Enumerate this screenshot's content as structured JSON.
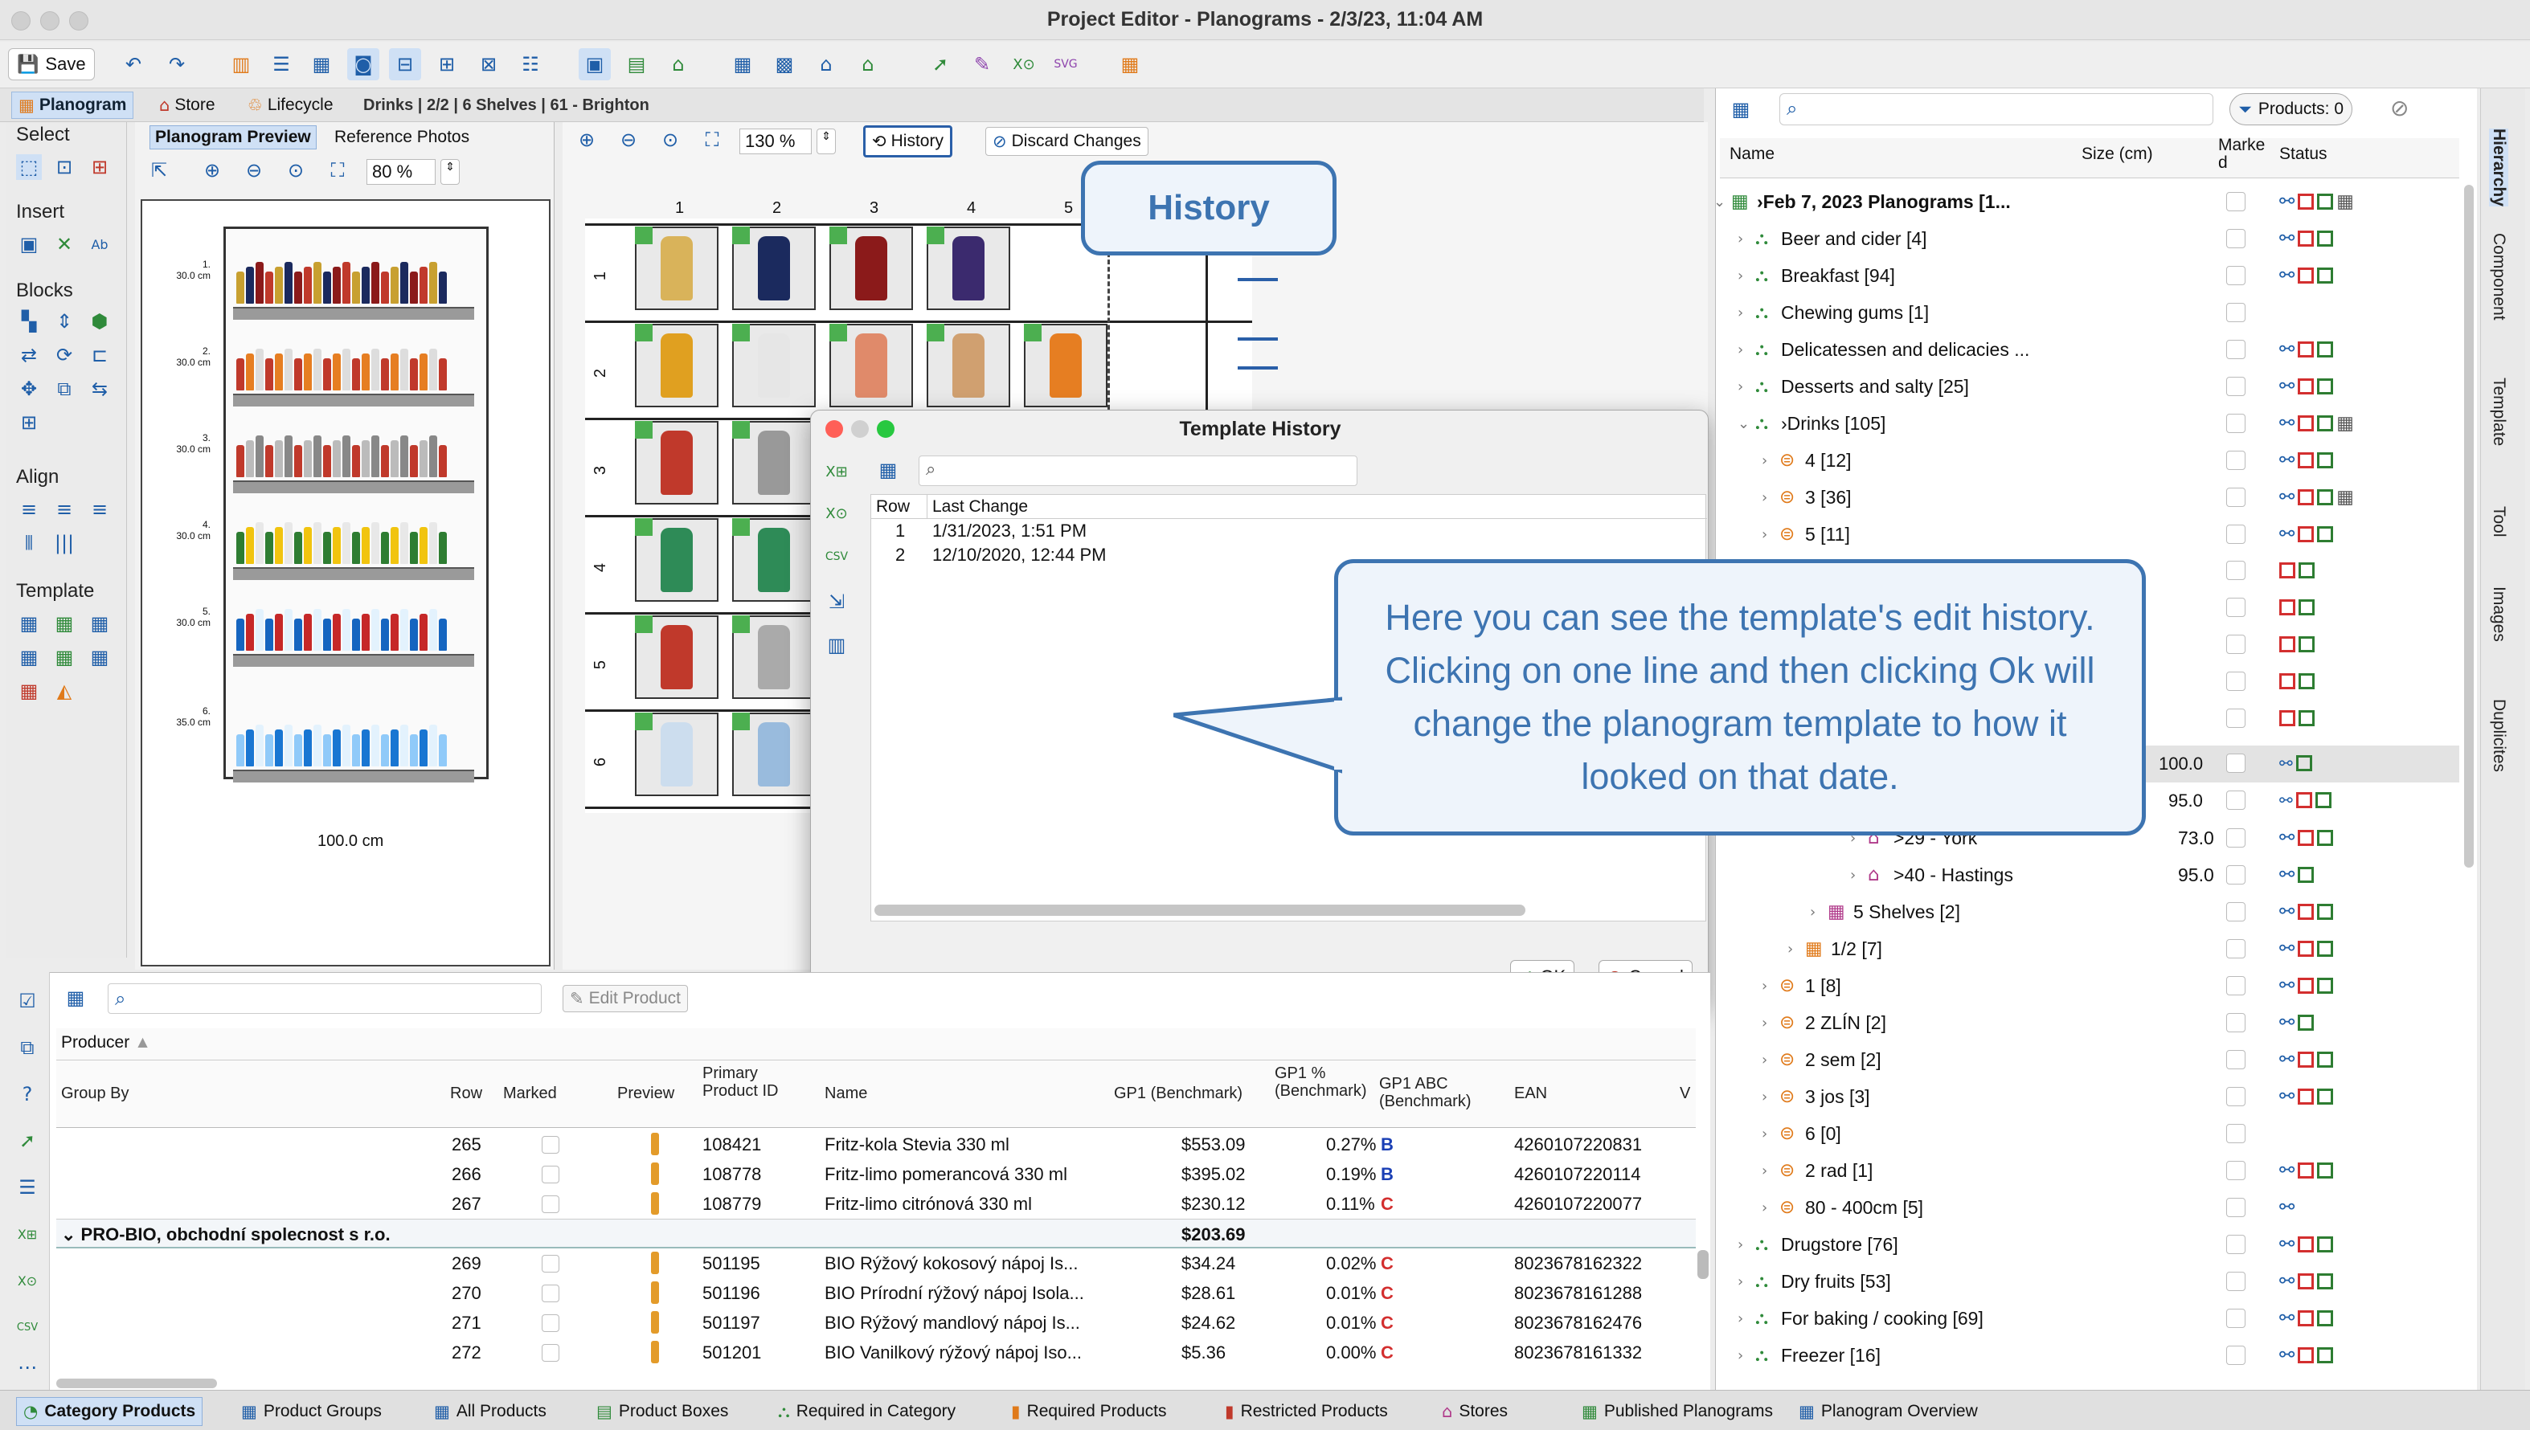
{
  "window": {
    "title": "Project Editor - Planograms - 2/3/23, 11:04 AM"
  },
  "toolbar": {
    "save_label": "Save"
  },
  "tabs": {
    "planogram": "Planogram",
    "store": "Store",
    "lifecycle": "Lifecycle",
    "breadcrumb": "Drinks | 2/2 | 6 Shelves | 61 - Brighton"
  },
  "palette": {
    "select": "Select",
    "insert": "Insert",
    "blocks": "Blocks",
    "align": "Align",
    "template": "Template"
  },
  "preview": {
    "tab_preview": "Planogram Preview",
    "tab_photos": "Reference Photos",
    "zoom": "80 %",
    "width_label": "100.0 cm",
    "shelf_labels": [
      "1.\n30.0 cm",
      "2.\n30.0 cm",
      "3.\n30.0 cm",
      "4.\n30.0 cm",
      "5.\n30.0 cm",
      "6.\n35.0 cm"
    ]
  },
  "editor": {
    "zoom": "130 %",
    "history_button": "History",
    "discard_button": "Discard Changes",
    "columns": [
      "1",
      "2",
      "3",
      "4",
      "5"
    ],
    "rows": [
      "1",
      "2",
      "3",
      "4",
      "5",
      "6"
    ]
  },
  "callouts": {
    "history": "History",
    "explanation": "Here you can see the template's edit history. Clicking on one line and then clicking Ok will change the planogram template to how it looked on that date."
  },
  "dialog": {
    "title": "Template History",
    "col_row": "Row",
    "col_change": "Last Change",
    "rows": [
      {
        "row": "1",
        "change": "1/31/2023, 1:51 PM"
      },
      {
        "row": "2",
        "change": "12/10/2020, 12:44 PM"
      }
    ],
    "ok": "OK",
    "cancel": "Cancel"
  },
  "hierarchy": {
    "products_badge": "Products: 0",
    "col_name": "Name",
    "col_size": "Size (cm)",
    "col_marked": "Marke\nd",
    "col_status": "Status",
    "items": [
      {
        "label": "›Feb 7, 2023 Planograms [1...",
        "bold": true
      },
      {
        "label": "Beer and cider [4]"
      },
      {
        "label": "Breakfast [94]"
      },
      {
        "label": "Chewing gums [1]"
      },
      {
        "label": "Delicatessen and delicacies ..."
      },
      {
        "label": "Desserts and salty [25]"
      },
      {
        "label": "›Drinks [105]"
      },
      {
        "label": "4 [12]"
      },
      {
        "label": "3 [36]"
      },
      {
        "label": "5 [11]"
      },
      {
        "label": ">29 - York",
        "size": "73.0"
      },
      {
        "label": ">40 - Hastings",
        "size": "95.0"
      },
      {
        "label": "5 Shelves [2]"
      },
      {
        "label": "1/2 [7]"
      },
      {
        "label": "1 [8]"
      },
      {
        "label": "2 ZLÍN [2]"
      },
      {
        "label": "2 sem [2]"
      },
      {
        "label": "3 jos [3]"
      },
      {
        "label": "6 [0]"
      },
      {
        "label": "2 rad [1]"
      },
      {
        "label": "80 - 400cm [5]"
      },
      {
        "label": "Drugstore [76]"
      },
      {
        "label": "Dry fruits [53]"
      },
      {
        "label": "For baking / cooking [69]"
      },
      {
        "label": "Freezer [16]"
      }
    ],
    "sizes_partial": [
      "100.0",
      "95.0"
    ]
  },
  "vertical_tabs": [
    "Hierarchy",
    "Component",
    "Template",
    "Tool",
    "Images",
    "Duplicites"
  ],
  "products": {
    "edit_button": "Edit Product",
    "group_chip": "Producer",
    "headers": {
      "group_by": "Group By",
      "row": "Row",
      "marked": "Marked",
      "preview": "Preview",
      "primary_id": "Primary Product ID",
      "name": "Name",
      "gp1": "GP1 (Benchmark)",
      "gp1pct": "GP1 % (Benchmark)",
      "gp1abc": "GP1 ABC (Benchmark)",
      "ean": "EAN",
      "v": "V"
    },
    "rows": [
      {
        "row": "265",
        "id": "108421",
        "name": "Fritz-kola Stevia 330 ml",
        "gp1": "$553.09",
        "pct": "0.27%",
        "abc": "B",
        "ean": "4260107220831"
      },
      {
        "row": "266",
        "id": "108778",
        "name": "Fritz-limo pomerancová 330 ml",
        "gp1": "$395.02",
        "pct": "0.19%",
        "abc": "B",
        "ean": "4260107220114"
      },
      {
        "row": "267",
        "id": "108779",
        "name": "Fritz-limo citrónová 330 ml",
        "gp1": "$230.12",
        "pct": "0.11%",
        "abc": "C",
        "ean": "4260107220077"
      }
    ],
    "group": {
      "name": "PRO-BIO, obchodní spolecnost s r.o.",
      "total": "$203.69"
    },
    "rows2": [
      {
        "row": "269",
        "id": "501195",
        "name": "BIO Rýžový kokosový nápoj Is...",
        "gp1": "$34.24",
        "pct": "0.02%",
        "abc": "C",
        "ean": "8023678162322"
      },
      {
        "row": "270",
        "id": "501196",
        "name": "BIO Prírodní rýžový nápoj Isola...",
        "gp1": "$28.61",
        "pct": "0.01%",
        "abc": "C",
        "ean": "8023678161288"
      },
      {
        "row": "271",
        "id": "501197",
        "name": "BIO Rýžový mandlový nápoj Is...",
        "gp1": "$24.62",
        "pct": "0.01%",
        "abc": "C",
        "ean": "8023678162476"
      },
      {
        "row": "272",
        "id": "501201",
        "name": "BIO Vanilkový rýžový nápoj Iso...",
        "gp1": "$5.36",
        "pct": "0.00%",
        "abc": "C",
        "ean": "8023678161332"
      }
    ]
  },
  "bottom_tabs": [
    "Category Products",
    "Product Groups",
    "All Products",
    "Product Boxes",
    "Required in Category",
    "Required Products",
    "Restricted Products",
    "Stores",
    "Published Planograms",
    "Planogram Overview"
  ],
  "colors": {
    "accent": "#3d74b1",
    "status_red": "#d32f2f",
    "status_green": "#2e7d32",
    "abc_b": "#1a3fb5",
    "abc_c": "#d32f2f"
  }
}
